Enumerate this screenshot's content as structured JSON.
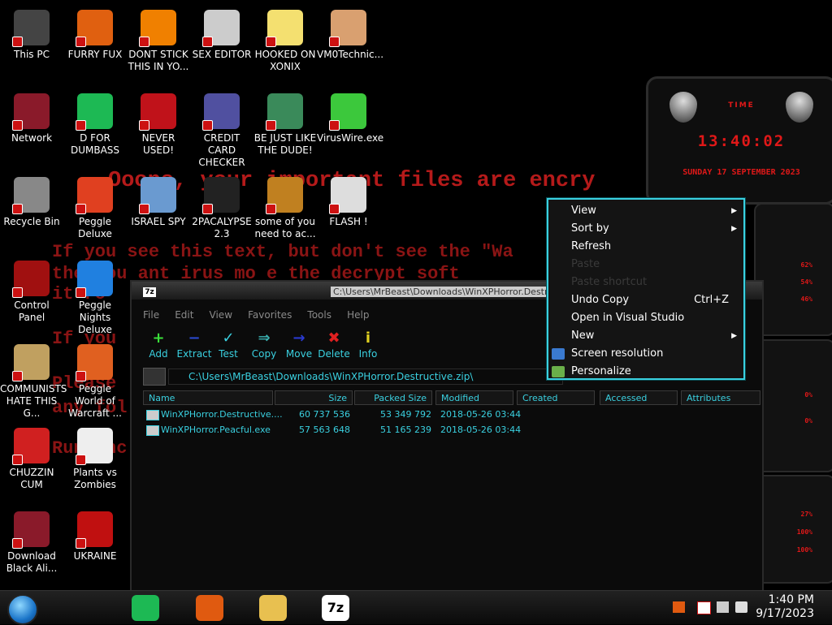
{
  "ransom": {
    "line1": "Ooops, your important files are encry",
    "line2a": "If you see this text, but don't see the \"Wa",
    "line2b": "the you  ant  irus  mo  e  the decrypt soft",
    "line3": "it  ro",
    "line4": "If  you",
    "line5": "Please",
    "line6": "any  fol",
    "line7": "Run  anc"
  },
  "desktop_icons": [
    {
      "label": "This PC",
      "icon": "this-pc-icon",
      "color": "#444"
    },
    {
      "label": "FURRY FUX",
      "icon": "furry-fux-icon",
      "color": "#e06010"
    },
    {
      "label": "DONT STICK THIS IN YO...",
      "icon": "vlc-cone-icon",
      "color": "#f08000"
    },
    {
      "label": "SEX EDITOR",
      "icon": "hex-editor-icon",
      "color": "#ccc"
    },
    {
      "label": "HOOKED ON XONIX",
      "icon": "cartoon-character-icon",
      "color": "#f4e070"
    },
    {
      "label": "VM0Technic...",
      "icon": "doctor-icon",
      "color": "#d9a070"
    },
    {
      "label": "Network",
      "icon": "alien-globe-icon",
      "color": "#8a1a2a"
    },
    {
      "label": "D FOR DUMBASS",
      "icon": "spotify-icon",
      "color": "#1db954"
    },
    {
      "label": "NEVER USED!",
      "icon": "dev-cpp-icon",
      "color": "#c0121a"
    },
    {
      "label": "CREDIT CARD CHECKER",
      "icon": "credit-card-icon",
      "color": "#5050a0"
    },
    {
      "label": "BE JUST LIKE THE DUDE!",
      "icon": "gnome-icon",
      "color": "#3a8a5a"
    },
    {
      "label": "VirusWire.exe",
      "icon": "limewire-icon",
      "color": "#3cc83c"
    },
    {
      "label": "Recycle Bin",
      "icon": "recycle-bin-icon",
      "color": "#888"
    },
    {
      "label": "Peggle Deluxe",
      "icon": "peggle-icon",
      "color": "#e04020"
    },
    {
      "label": "ISRAEL SPY",
      "icon": "remote-desktop-icon",
      "color": "#6a9ad0"
    },
    {
      "label": "2PACALYPSE 2.3",
      "icon": "terminal-icon",
      "color": "#222"
    },
    {
      "label": "some of you need to ac...",
      "icon": "dog-icon",
      "color": "#c08020"
    },
    {
      "label": "FLASH !",
      "icon": "flash-cards-icon",
      "color": "#ddd"
    },
    {
      "label": "Control Panel",
      "icon": "control-panel-icon",
      "color": "#a01010"
    },
    {
      "label": "Peggle Nights Deluxe",
      "icon": "peggle-nights-icon",
      "color": "#2080e0"
    },
    {
      "label": "COMMUNISTS HATE THIS G...",
      "icon": "money-bag-icon",
      "color": "#c0a060"
    },
    {
      "label": "Peggle World of Warcraft ...",
      "icon": "peggle-wow-icon",
      "color": "#e06020"
    },
    {
      "label": "CHUZZIN CUM",
      "icon": "chuzzle-icon",
      "color": "#d02020"
    },
    {
      "label": "Plants vs Zombies",
      "icon": "plants-vs-zombies-icon",
      "color": "#eee"
    },
    {
      "label": "Download Black Ali...",
      "icon": "alien-download-icon",
      "color": "#8a1a2a"
    },
    {
      "label": "UKRAINE",
      "icon": "radiation-icon",
      "color": "#c01010"
    }
  ],
  "gadget": {
    "title": "TIME",
    "time": "13:40:02",
    "date": "SUNDAY 17 SEPTEMBER 2023",
    "stats": [
      "62%",
      "54%",
      "46%",
      "0%",
      "0%",
      "27%",
      "100%",
      "100%"
    ]
  },
  "window": {
    "title": "C:\\Users\\MrBeast\\Downloads\\WinXPHorror.Destructive...",
    "title_icon": "7z",
    "menu": [
      "File",
      "Edit",
      "View",
      "Favorites",
      "Tools",
      "Help"
    ],
    "toolbar": [
      {
        "label": "Add",
        "glyph": "+",
        "color": "#3ae03a"
      },
      {
        "label": "Extract",
        "glyph": "−",
        "color": "#2a4ad0"
      },
      {
        "label": "Test",
        "glyph": "✓",
        "color": "#3ad0e0"
      },
      {
        "label": "Copy",
        "glyph": "⇒",
        "color": "#3ab0b0"
      },
      {
        "label": "Move",
        "glyph": "→",
        "color": "#2a3ad0"
      },
      {
        "label": "Delete",
        "glyph": "✖",
        "color": "#e02020"
      },
      {
        "label": "Info",
        "glyph": "i",
        "color": "#e0d020"
      }
    ],
    "address": "C:\\Users\\MrBeast\\Downloads\\WinXPHorror.Destructive.zip\\",
    "columns": [
      "Name",
      "Size",
      "Packed Size",
      "Modified",
      "Created",
      "Accessed",
      "Attributes"
    ],
    "rows": [
      {
        "name": "WinXPHorror.Destructive....",
        "size": "60 737 536",
        "packed": "53 349 792",
        "modified": "2018-05-26 03:44"
      },
      {
        "name": "WinXPHorror.Peacful.exe",
        "size": "57 563 648",
        "packed": "51 165 239",
        "modified": "2018-05-26 03:44"
      }
    ]
  },
  "context_menu": {
    "items": [
      {
        "label": "View",
        "submenu": true,
        "disabled": false
      },
      {
        "label": "Sort by",
        "submenu": true,
        "disabled": false
      },
      {
        "label": "Refresh",
        "submenu": false,
        "disabled": false
      },
      {
        "label": "Paste",
        "submenu": false,
        "disabled": true
      },
      {
        "label": "Paste shortcut",
        "submenu": false,
        "disabled": true
      },
      {
        "label": "Undo Copy",
        "shortcut": "Ctrl+Z",
        "submenu": false,
        "disabled": false
      },
      {
        "label": "Open in Visual Studio",
        "submenu": false,
        "disabled": false
      },
      {
        "label": "New",
        "submenu": true,
        "disabled": false
      },
      {
        "label": "Screen resolution",
        "icon": "display-icon",
        "submenu": false,
        "disabled": false
      },
      {
        "label": "Personalize",
        "icon": "personalize-icon",
        "submenu": false,
        "disabled": false
      }
    ]
  },
  "taskbar": {
    "pinned": [
      {
        "name": "spotify-taskbar-icon",
        "color": "#1db954"
      },
      {
        "name": "firefox-taskbar-icon",
        "color": "#e05a10"
      },
      {
        "name": "file-explorer-taskbar-icon",
        "color": "#e8c050"
      },
      {
        "name": "7zip-taskbar-icon",
        "color": "#fff",
        "label": "7z"
      }
    ],
    "time": "1:40 PM",
    "date": "9/17/2023"
  }
}
